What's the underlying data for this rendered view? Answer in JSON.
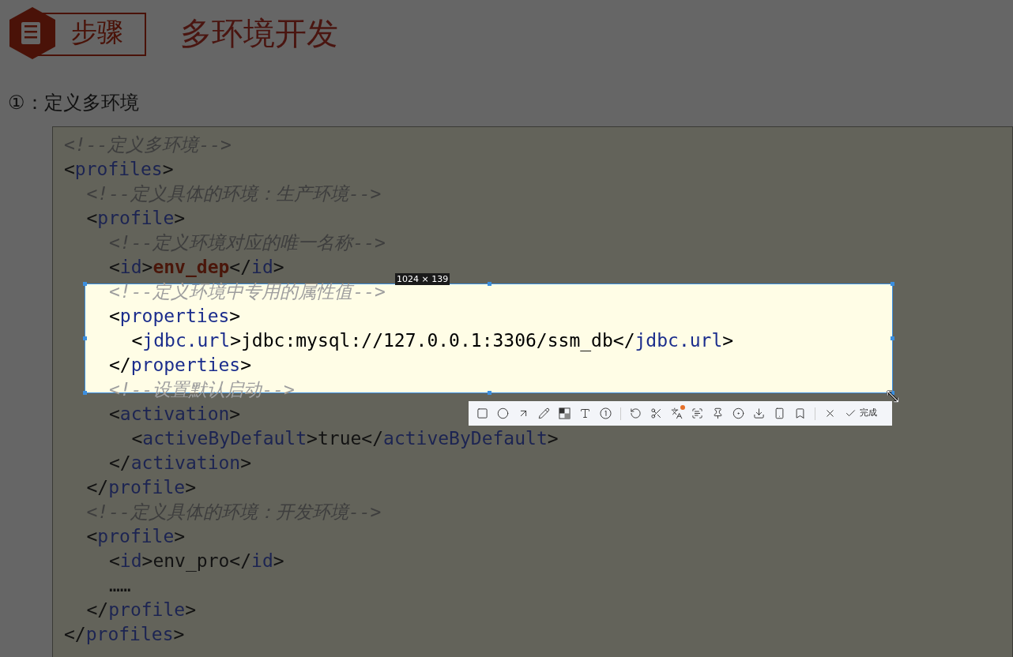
{
  "header": {
    "badge": "步骤",
    "title": "多环境开发"
  },
  "step": "①：定义多环境",
  "code": [
    {
      "highlighted": false,
      "tokens": [
        {
          "kind": "comment",
          "text": "<!--定义多环境-->"
        }
      ]
    },
    {
      "highlighted": false,
      "tokens": [
        {
          "kind": "punct",
          "text": "<"
        },
        {
          "kind": "tag",
          "text": "profiles"
        },
        {
          "kind": "punct",
          "text": ">"
        }
      ],
      "children": [
        {
          "highlighted": false,
          "tokens": [
            {
              "kind": "comment",
              "text": "<!--定义具体的环境：生产环境-->"
            }
          ]
        },
        {
          "highlighted": false,
          "tokens": [
            {
              "kind": "punct",
              "text": "<"
            },
            {
              "kind": "tag",
              "text": "profile"
            },
            {
              "kind": "punct",
              "text": ">"
            }
          ],
          "children": [
            {
              "highlighted": false,
              "tokens": [
                {
                  "kind": "comment",
                  "text": "<!--定义环境对应的唯一名称-->"
                }
              ]
            },
            {
              "highlighted": false,
              "tokens": [
                {
                  "kind": "punct",
                  "text": "<"
                },
                {
                  "kind": "tag",
                  "text": "id"
                },
                {
                  "kind": "punct",
                  "text": ">"
                },
                {
                  "kind": "value",
                  "text": "env_dep"
                },
                {
                  "kind": "punct",
                  "text": "</"
                },
                {
                  "kind": "tag",
                  "text": "id"
                },
                {
                  "kind": "punct",
                  "text": ">"
                }
              ]
            },
            {
              "highlighted": true,
              "tokens": [
                {
                  "kind": "comment",
                  "text": "<!--定义环境中专用的属性值-->"
                }
              ]
            },
            {
              "highlighted": true,
              "tokens": [
                {
                  "kind": "punct",
                  "text": "<"
                },
                {
                  "kind": "tag",
                  "text": "properties"
                },
                {
                  "kind": "punct",
                  "text": ">"
                }
              ],
              "children": [
                {
                  "highlighted": true,
                  "tokens": [
                    {
                      "kind": "punct",
                      "text": "<"
                    },
                    {
                      "kind": "tag",
                      "text": "jdbc.url"
                    },
                    {
                      "kind": "punct",
                      "text": ">"
                    },
                    {
                      "kind": "text",
                      "text": "jdbc:mysql://127.0.0.1:3306/ssm_db"
                    },
                    {
                      "kind": "punct",
                      "text": "</"
                    },
                    {
                      "kind": "tag",
                      "text": "jdbc.url"
                    },
                    {
                      "kind": "punct",
                      "text": ">"
                    }
                  ]
                }
              ]
            },
            {
              "highlighted": true,
              "tokens": [
                {
                  "kind": "punct",
                  "text": "</"
                },
                {
                  "kind": "tag",
                  "text": "properties"
                },
                {
                  "kind": "punct",
                  "text": ">"
                }
              ]
            },
            {
              "highlighted": true,
              "tokens": [
                {
                  "kind": "comment",
                  "text": "<!--设置默认启动-->"
                }
              ]
            },
            {
              "highlighted": false,
              "tokens": [
                {
                  "kind": "punct",
                  "text": "<"
                },
                {
                  "kind": "tag",
                  "text": "activation"
                },
                {
                  "kind": "punct",
                  "text": ">"
                }
              ],
              "children": [
                {
                  "highlighted": false,
                  "tokens": [
                    {
                      "kind": "punct",
                      "text": "<"
                    },
                    {
                      "kind": "tag",
                      "text": "activeByDefault"
                    },
                    {
                      "kind": "punct",
                      "text": ">"
                    },
                    {
                      "kind": "text",
                      "text": "true"
                    },
                    {
                      "kind": "punct",
                      "text": "</"
                    },
                    {
                      "kind": "tag",
                      "text": "activeByDefault"
                    },
                    {
                      "kind": "punct",
                      "text": ">"
                    }
                  ]
                }
              ]
            },
            {
              "highlighted": false,
              "tokens": [
                {
                  "kind": "punct",
                  "text": "</"
                },
                {
                  "kind": "tag",
                  "text": "activation"
                },
                {
                  "kind": "punct",
                  "text": ">"
                }
              ]
            }
          ]
        },
        {
          "highlighted": false,
          "tokens": [
            {
              "kind": "punct",
              "text": "</"
            },
            {
              "kind": "tag",
              "text": "profile"
            },
            {
              "kind": "punct",
              "text": ">"
            }
          ]
        },
        {
          "highlighted": false,
          "tokens": [
            {
              "kind": "comment",
              "text": "<!--定义具体的环境：开发环境-->"
            }
          ]
        },
        {
          "highlighted": false,
          "tokens": [
            {
              "kind": "punct",
              "text": "<"
            },
            {
              "kind": "tag",
              "text": "profile"
            },
            {
              "kind": "punct",
              "text": ">"
            }
          ],
          "children": [
            {
              "highlighted": false,
              "tokens": [
                {
                  "kind": "punct",
                  "text": "<"
                },
                {
                  "kind": "tag",
                  "text": "id"
                },
                {
                  "kind": "punct",
                  "text": ">"
                },
                {
                  "kind": "text",
                  "text": "env_pro"
                },
                {
                  "kind": "punct",
                  "text": "</"
                },
                {
                  "kind": "tag",
                  "text": "id"
                },
                {
                  "kind": "punct",
                  "text": ">"
                }
              ]
            },
            {
              "highlighted": false,
              "tokens": [
                {
                  "kind": "text",
                  "text": "……"
                }
              ]
            }
          ]
        },
        {
          "highlighted": false,
          "tokens": [
            {
              "kind": "punct",
              "text": "</"
            },
            {
              "kind": "tag",
              "text": "profile"
            },
            {
              "kind": "punct",
              "text": ">"
            }
          ]
        }
      ]
    },
    {
      "highlighted": false,
      "tokens": [
        {
          "kind": "punct",
          "text": "</"
        },
        {
          "kind": "tag",
          "text": "profiles"
        },
        {
          "kind": "punct",
          "text": ">"
        }
      ]
    }
  ],
  "capture": {
    "size_label": "1024 × 139",
    "confirm_label": "完成"
  }
}
